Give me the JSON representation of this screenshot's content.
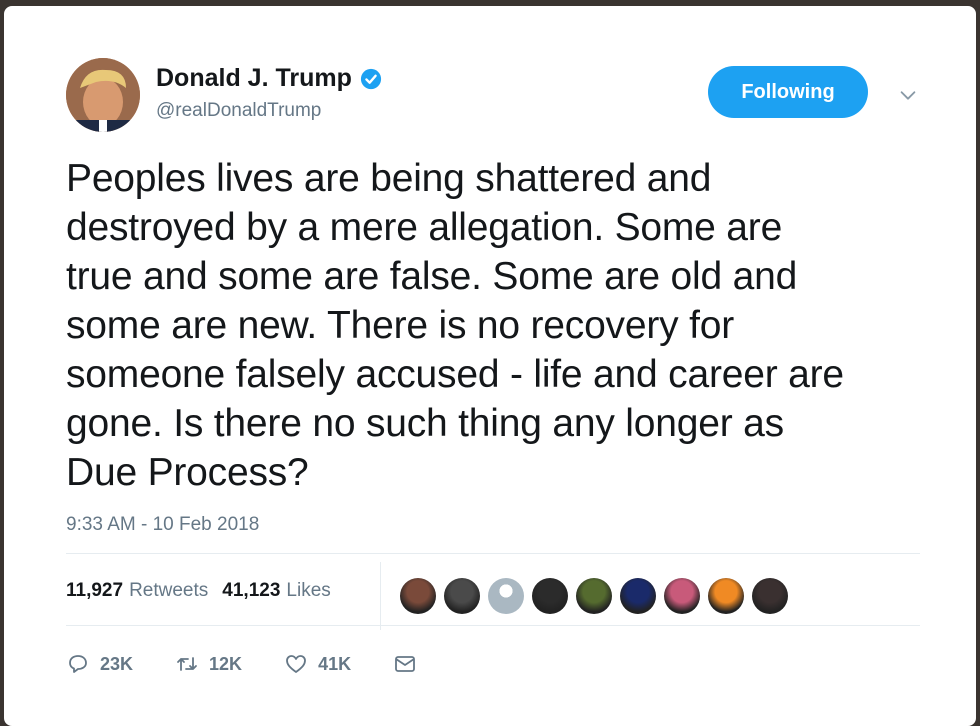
{
  "author": {
    "name": "Donald J. Trump",
    "handle": "@realDonaldTrump",
    "verified": true,
    "accent_color": "#1da1f2"
  },
  "follow_button": {
    "label": "Following"
  },
  "menu": {
    "icon": "chevron-down-icon"
  },
  "tweet": {
    "lines": [
      "Peoples lives are being shattered and",
      "destroyed by a mere allegation. Some are",
      "true and some are false. Some are old and",
      "some are new. There is no recovery for",
      "someone falsely accused - life and career are",
      "gone. Is there no such thing any longer as",
      "Due Process?"
    ],
    "timestamp": "9:33 AM - 10 Feb 2018"
  },
  "stats": {
    "retweets_count": "11,927",
    "retweets_label": "Retweets",
    "likes_count": "41,123",
    "likes_label": "Likes"
  },
  "likers": [
    {
      "color": "#7a4a3a"
    },
    {
      "color": "#4a4a4a"
    },
    {
      "color": "#aab8c2"
    },
    {
      "color": "#2b2b2b"
    },
    {
      "color": "#556b2f"
    },
    {
      "color": "#1a2a6a"
    },
    {
      "color": "#c85a7a"
    },
    {
      "color": "#f08a24"
    },
    {
      "color": "#3a3030"
    }
  ],
  "actions": {
    "reply_count": "23K",
    "retweet_count": "12K",
    "like_count": "41K",
    "message_icon": "envelope-icon"
  }
}
